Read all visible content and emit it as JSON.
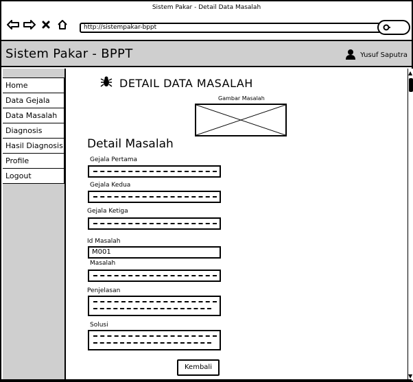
{
  "window": {
    "title": "Sistem Pakar - Detail Data Masalah",
    "url": "http://sistempakar-bppt"
  },
  "app": {
    "title": "Sistem Pakar - BPPT",
    "user": "Yusuf Saputra"
  },
  "sidebar": {
    "items": [
      {
        "label": "Home"
      },
      {
        "label": "Data Gejala"
      },
      {
        "label": "Data Masalah"
      },
      {
        "label": "Diagnosis"
      },
      {
        "label": "Hasil Diagnosis"
      },
      {
        "label": "Profile"
      },
      {
        "label": "Logout"
      }
    ]
  },
  "main": {
    "heading": "DETAIL DATA MASALAH",
    "image_label": "Gambar Masalah",
    "section_title": "Detail Masalah",
    "fields": {
      "gejala_pertama": "Gejala Pertama",
      "gejala_kedua": "Gejala Kedua",
      "gejala_ketiga": "Gejala Ketiga",
      "id_masalah": "Id Masalah",
      "id_masalah_value": "M001",
      "masalah": "Masalah",
      "penjelasan": "Penjelasan",
      "solusi": "Solusi"
    },
    "button_back": "Kembali"
  },
  "icons": {
    "back": "arrow-left-icon",
    "forward": "arrow-right-icon",
    "stop": "close-icon",
    "home": "home-icon",
    "search": "search-icon",
    "user": "user-icon",
    "heading": "bug-icon"
  }
}
